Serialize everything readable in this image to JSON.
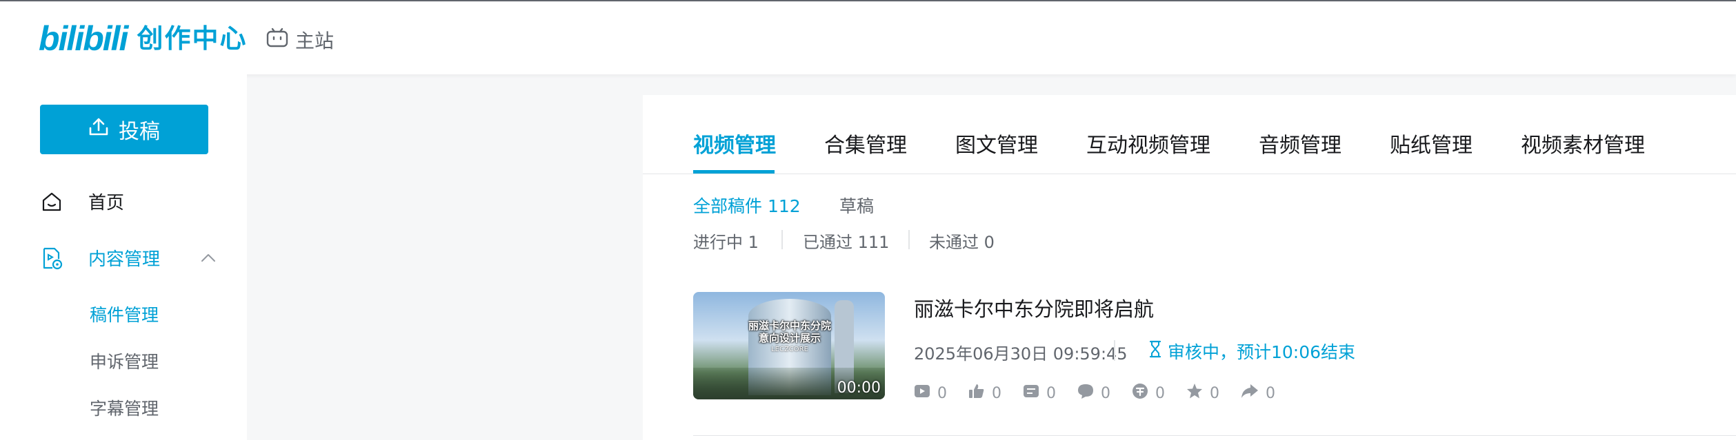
{
  "header": {
    "logo_mark": "bilibili",
    "logo_text": "创作中心",
    "main_site_label": "主站"
  },
  "sidebar": {
    "upload_label": "投稿",
    "nav": {
      "home_label": "首页",
      "content_label": "内容管理"
    },
    "sub_items": [
      "稿件管理",
      "申诉管理",
      "字幕管理"
    ]
  },
  "tabs": [
    "视频管理",
    "合集管理",
    "图文管理",
    "互动视频管理",
    "音频管理",
    "贴纸管理",
    "视频素材管理"
  ],
  "active_tab": "视频管理",
  "filters": {
    "all_label": "全部稿件",
    "all_count": "112",
    "drafts_label": "草稿",
    "in_progress_label": "进行中",
    "in_progress_count": "1",
    "passed_label": "已通过",
    "passed_count": "111",
    "rejected_label": "未通过",
    "rejected_count": "0"
  },
  "videos": [
    {
      "thumb_caption_line1": "丽滋卡尔中东分院",
      "thumb_caption_line2": "意向设计展示",
      "thumb_caption_line3": "LECZCORE",
      "duration": "00:00",
      "title": "丽滋卡尔中东分院即将启航",
      "time": "2025年06月30日 09:59:45",
      "status": "审核中，预计10:06结束",
      "stats": {
        "plays": "0",
        "likes": "0",
        "danmaku": "0",
        "comments": "0",
        "coins": "0",
        "favorites": "0",
        "shares": "0"
      }
    }
  ],
  "colors": {
    "accent": "#00a1d6",
    "text_primary": "#18191c",
    "text_secondary": "#61666d",
    "text_muted": "#9499a0",
    "divider": "#e3e5e7",
    "background": "#f6f7f8"
  },
  "icons": {
    "main_site": "tv-icon",
    "upload": "upload-icon",
    "home": "home-icon",
    "content": "content-file-icon",
    "status": "hourglass-icon"
  }
}
